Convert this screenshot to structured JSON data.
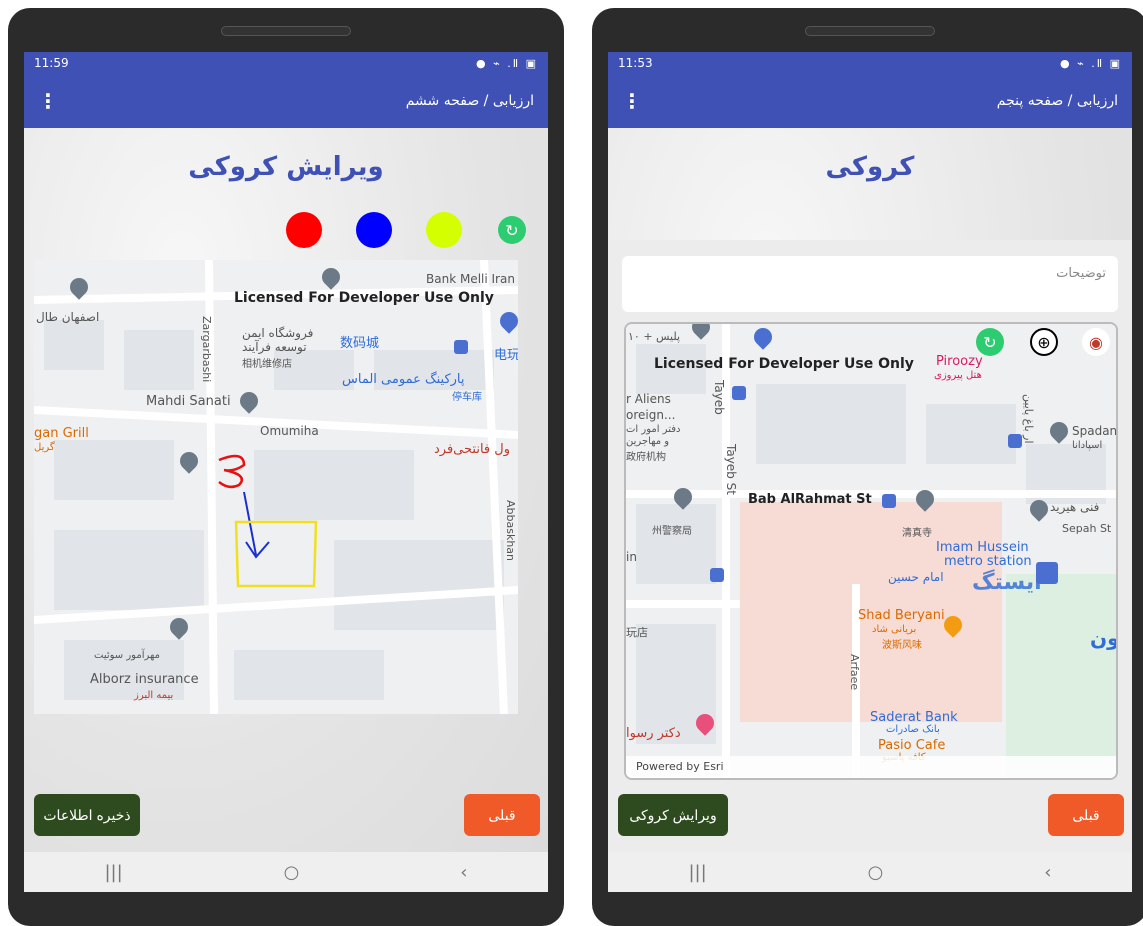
{
  "left": {
    "status_time": "11:59",
    "status_icons": "● ⌁ .Ⅱ ▣",
    "appbar_menu_icon": "⋮",
    "appbar_title": "ارزیابی / صفحه ششم",
    "page_title": "ویرایش کروکی",
    "color_dots": [
      "#ff0000",
      "#0000ff",
      "#d4ff00"
    ],
    "refresh_icon": "refresh-icon",
    "map": {
      "license": "Licensed For Developer Use Only",
      "labels": [
        "Bank Melli Iran",
        "اصفهان طال",
        "فروشگاه ایمن",
        "توسعه فرآیند",
        "相机维修店",
        "数码城",
        "电玩",
        "پارکینگ عمومی الماس",
        "停车库",
        "Mahdi Sanati",
        "Omumiha",
        "gan Grill",
        "گریل",
        "ول فانتحی‌فرد",
        "Zargarbashi",
        "Abbaskhan",
        "مهرآمور سوئیت",
        "Alborz insurance",
        "بیمه البرز"
      ]
    },
    "save_button": "ذخیره اطلاعات",
    "back_button": "قبلی",
    "nav": {
      "recent": "|||",
      "home": "○",
      "back": "‹"
    }
  },
  "right": {
    "status_time": "11:53",
    "status_icons": "● ⌁ .Ⅱ ▣",
    "appbar_menu_icon": "⋮",
    "appbar_title": "ارزیابی / صفحه پنجم",
    "page_title": "کروکی",
    "description_placeholder": "توضیحات",
    "map": {
      "license": "Licensed For Developer Use Only",
      "labels": [
        "پلیس + ۱۰",
        "Piroozy",
        "هتل پیروزی",
        "ار باغ پایین",
        "r Aliens",
        "oreign...",
        "دفتر امور ات",
        "و مهاجرین",
        "政府机构",
        "Tayeb",
        "Spadan",
        "اسپادانا",
        "Tayeb St",
        "Bab AlRahmat St",
        "فنی هیرید",
        "Sepah St",
        "州警察局",
        "清真寺",
        "Imam Hussein",
        "metro station",
        "امام حسین",
        "ایستگ",
        "in",
        "Shad Beryani",
        "بریانی شاد",
        "波斯风味",
        "玩店",
        "ون",
        "Arfaee",
        "Saderat Bank",
        "بانک صادرات",
        "Pasio Cafe",
        "کافه پاسیو",
        "دکتر رسوا"
      ],
      "credit": "Powered by Esri"
    },
    "edit_button": "ویرایش کروکی",
    "back_button": "قبلی",
    "nav": {
      "recent": "|||",
      "home": "○",
      "back": "‹"
    }
  }
}
